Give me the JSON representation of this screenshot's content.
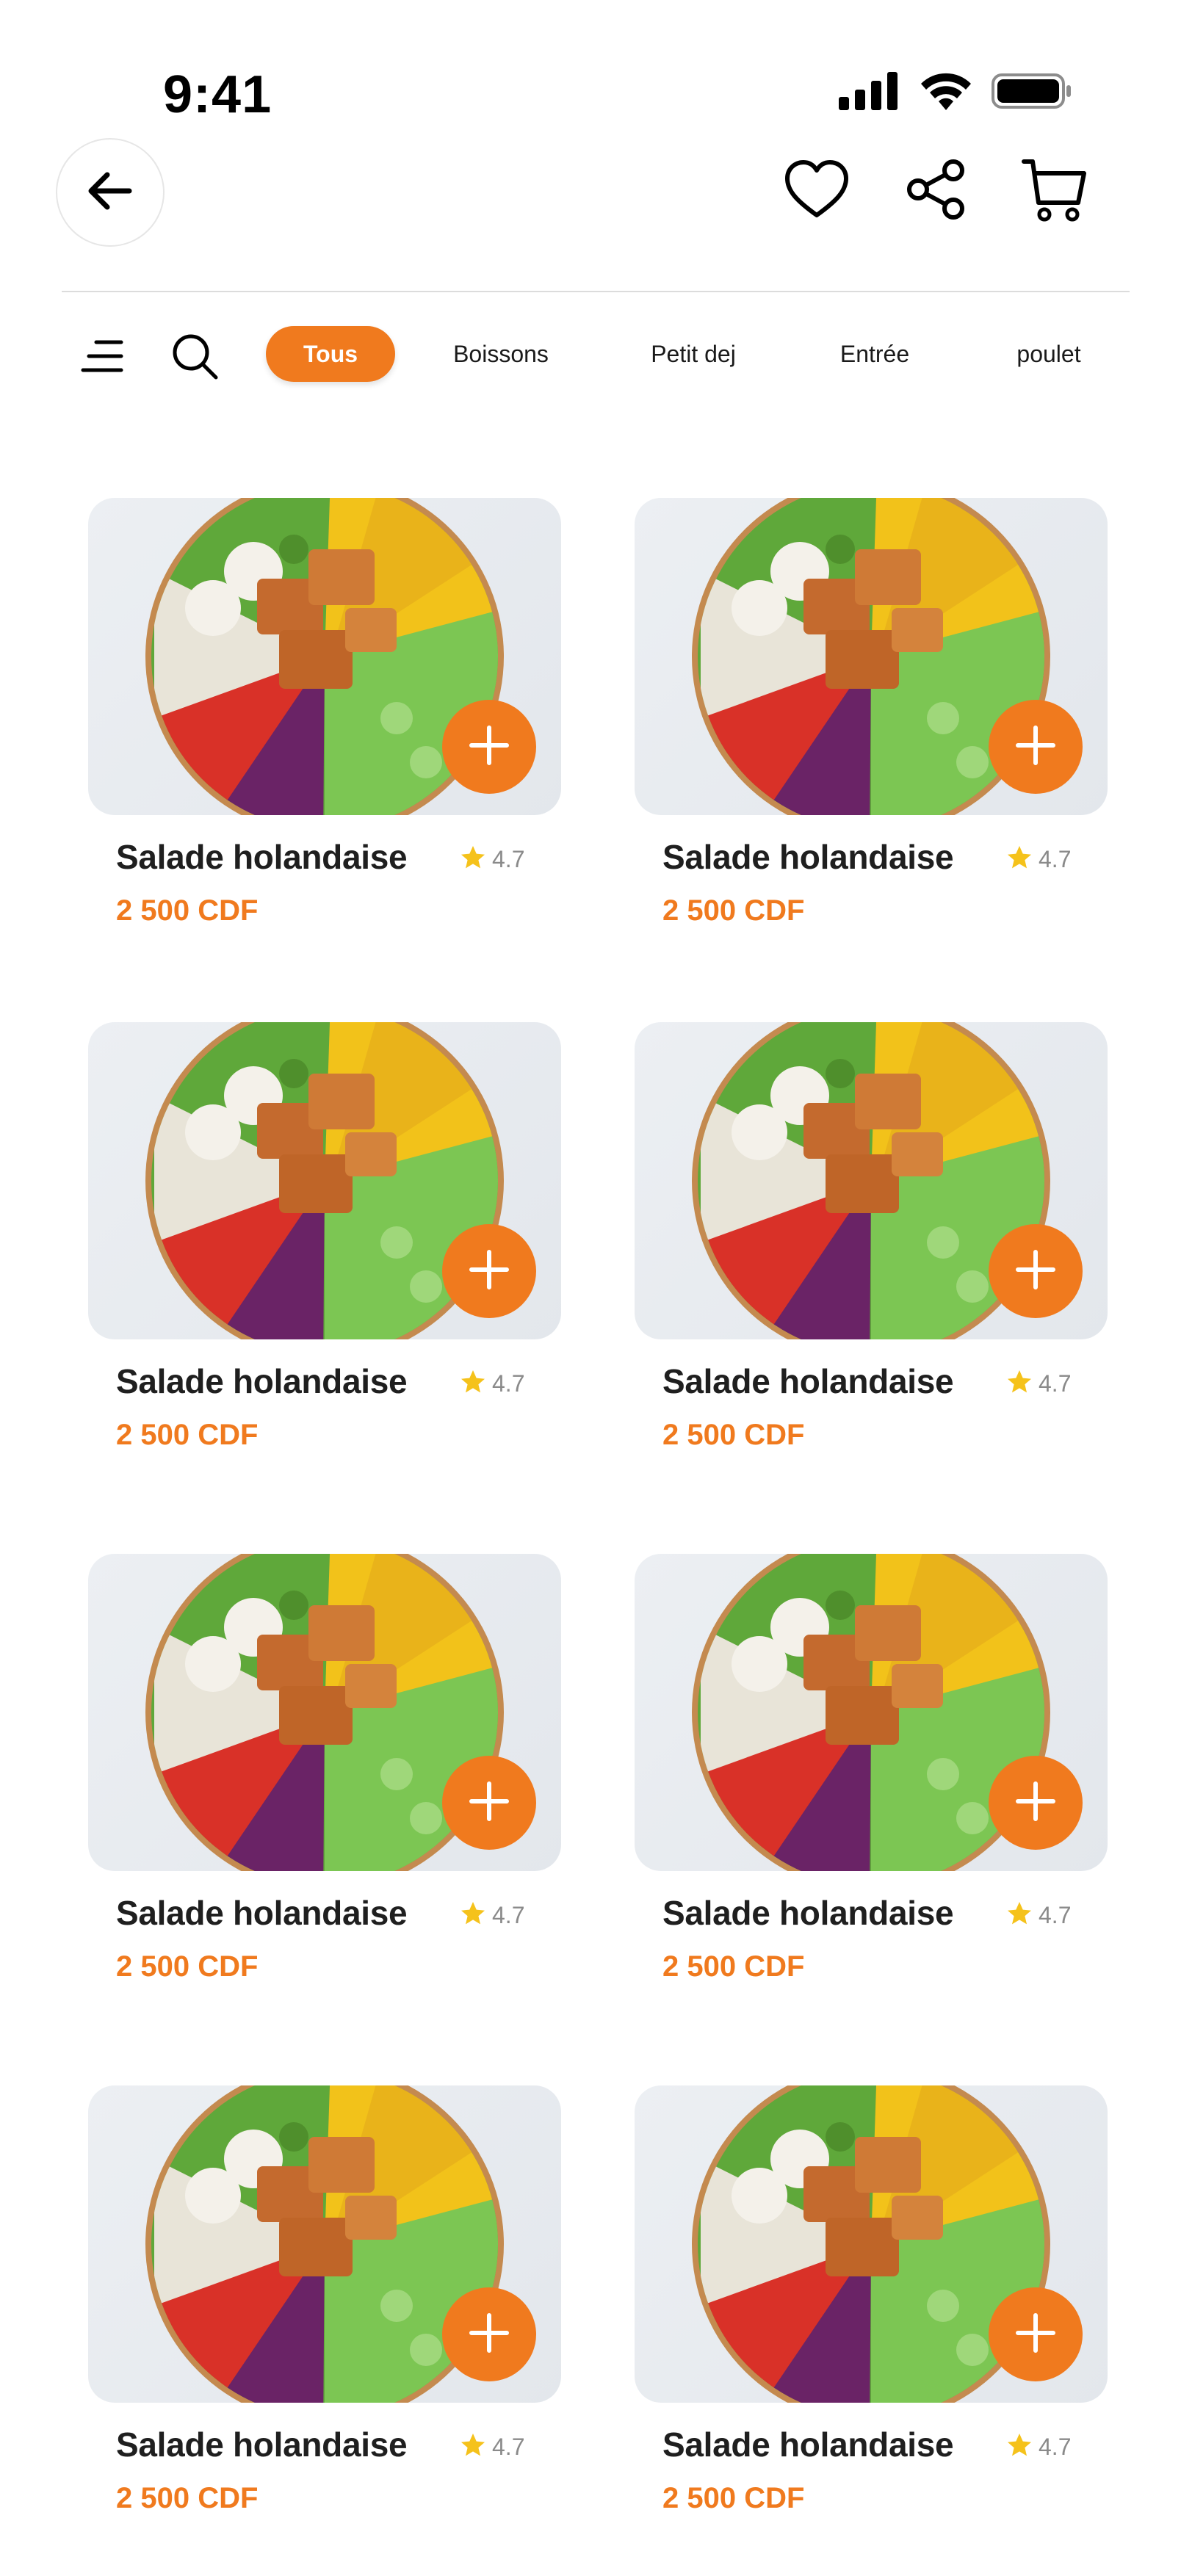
{
  "status_bar": {
    "time": "9:41"
  },
  "filters": {
    "chips": [
      {
        "label": "Tous",
        "active": true
      },
      {
        "label": "Boissons",
        "active": false
      },
      {
        "label": "Petit dej",
        "active": false
      },
      {
        "label": "Entrée",
        "active": false
      },
      {
        "label": "poulet",
        "active": false
      }
    ]
  },
  "products": [
    {
      "name": "Salade holandaise",
      "rating": "4.7",
      "price": "2 500 CDF"
    },
    {
      "name": "Salade holandaise",
      "rating": "4.7",
      "price": "2 500 CDF"
    },
    {
      "name": "Salade holandaise",
      "rating": "4.7",
      "price": "2 500 CDF"
    },
    {
      "name": "Salade holandaise",
      "rating": "4.7",
      "price": "2 500 CDF"
    },
    {
      "name": "Salade holandaise",
      "rating": "4.7",
      "price": "2 500 CDF"
    },
    {
      "name": "Salade holandaise",
      "rating": "4.7",
      "price": "2 500 CDF"
    },
    {
      "name": "Salade holandaise",
      "rating": "4.7",
      "price": "2 500 CDF"
    },
    {
      "name": "Salade holandaise",
      "rating": "4.7",
      "price": "2 500 CDF"
    }
  ],
  "colors": {
    "accent": "#f07a1e",
    "star": "#f5c21b"
  },
  "icons": [
    "signal-icon",
    "wifi-icon",
    "battery-icon",
    "back-arrow-icon",
    "heart-icon",
    "share-icon",
    "cart-icon",
    "menu-icon",
    "search-icon",
    "plus-icon",
    "star-icon"
  ]
}
